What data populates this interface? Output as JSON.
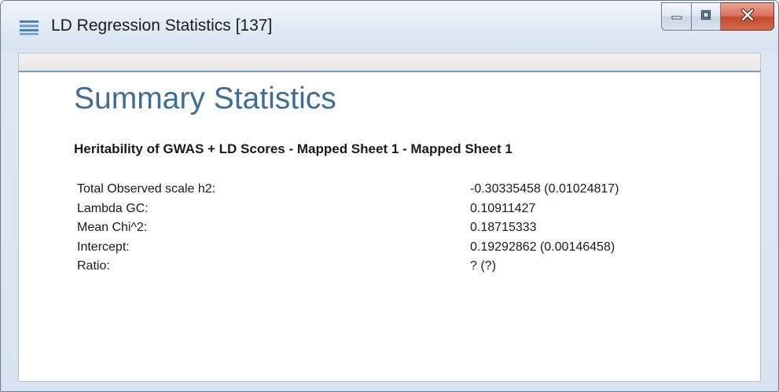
{
  "window": {
    "title": "LD Regression Statistics [137]",
    "icon": "menu-lines-icon",
    "controls": {
      "minimize_icon": "minimize-icon",
      "maximize_icon": "maximize-icon",
      "close_icon": "close-icon"
    }
  },
  "content": {
    "heading": "Summary Statistics",
    "subheading": "Heritability of GWAS + LD Scores - Mapped Sheet 1 - Mapped Sheet 1",
    "stats": [
      {
        "label": "Total Observed scale h2:",
        "value": "-0.30335458 (0.01024817)"
      },
      {
        "label": "Lambda GC:",
        "value": "0.10911427"
      },
      {
        "label": "Mean Chi^2:",
        "value": "0.18715333"
      },
      {
        "label": "Intercept:",
        "value": "0.19292862 (0.00146458)"
      },
      {
        "label": "Ratio:",
        "value": "? (?)"
      }
    ]
  },
  "colors": {
    "heading": "#3d6e97",
    "close_button": "#c44a2e",
    "app_icon": "#4a7fc0"
  }
}
